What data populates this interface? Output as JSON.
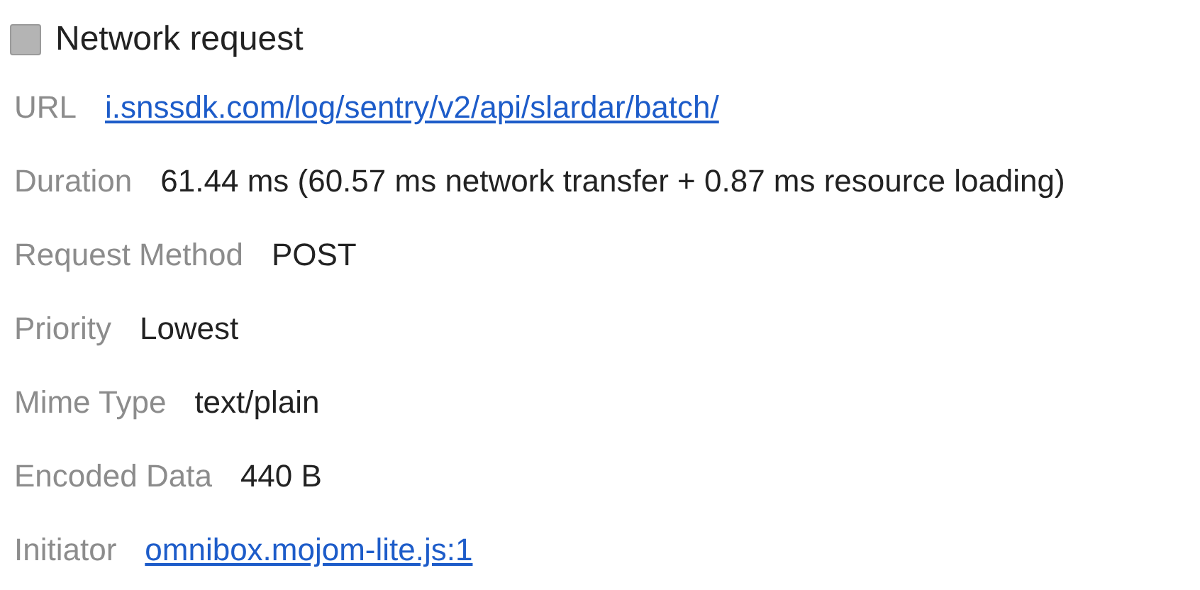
{
  "title": "Network request",
  "rows": [
    {
      "label": "URL",
      "value": "i.snssdk.com/log/sentry/v2/api/slardar/batch/",
      "kind": "link"
    },
    {
      "label": "Duration",
      "value": "61.44 ms (60.57 ms network transfer + 0.87 ms resource loading)",
      "kind": "text"
    },
    {
      "label": "Request Method",
      "value": "POST",
      "kind": "text"
    },
    {
      "label": "Priority",
      "value": "Lowest",
      "kind": "text"
    },
    {
      "label": "Mime Type",
      "value": "text/plain",
      "kind": "text"
    },
    {
      "label": "Encoded Data",
      "value": "440 B",
      "kind": "text"
    },
    {
      "label": "Initiator",
      "value": "omnibox.mojom-lite.js:1",
      "kind": "link"
    }
  ]
}
